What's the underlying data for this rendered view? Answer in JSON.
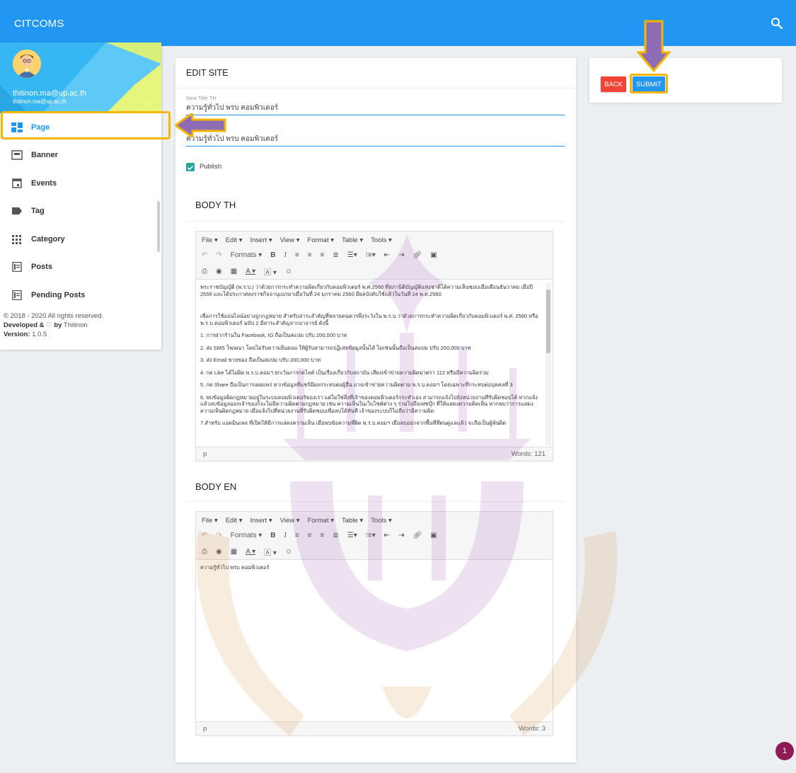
{
  "app": {
    "brand": "CITCOMS"
  },
  "user": {
    "name": "thitinon.ma@up.ac.th",
    "email": "thitinon.ma@up.ac.th"
  },
  "sidebar": {
    "items": [
      {
        "label": "Page",
        "icon": "dashboard-icon",
        "active": true
      },
      {
        "label": "Banner",
        "icon": "banner-icon"
      },
      {
        "label": "Events",
        "icon": "calendar-icon"
      },
      {
        "label": "Tag",
        "icon": "tag-icon"
      },
      {
        "label": "Category",
        "icon": "grid-icon"
      },
      {
        "label": "Posts",
        "icon": "posts-icon"
      },
      {
        "label": "Pending Posts",
        "icon": "pending-posts-icon"
      }
    ],
    "footer": {
      "copyright": "© 2018 - 2020 All rights reserved.",
      "developed_prefix": "Developed &",
      "developed_by": "by",
      "developer": "Thitinon",
      "version_label": "Version:",
      "version": "1.0.5"
    }
  },
  "form": {
    "title": "EDIT SITE",
    "title_th_label": "New Title TH",
    "title_th_value": "ความรู้ทั่วไป พรบ คอมพิวเตอร์",
    "title_en_value": "ความรู้ทั่วไป พรบ คอมพิวเตอร์",
    "publish_label": "Publish",
    "publish_checked": true,
    "body_th_title": "BODY TH",
    "body_en_title": "BODY EN"
  },
  "editor": {
    "menus": [
      "File ▾",
      "Edit ▾",
      "Insert ▾",
      "View ▾",
      "Format ▾",
      "Table ▾",
      "Tools ▾"
    ],
    "formats_label": "Formats ▾",
    "path_label": "p",
    "th_words": "Words: 121",
    "en_words": "Words: 3",
    "th_paragraphs": [
      "พระราชบัญญัติ (พ.ร.บ.) ว่าด้วยการกระทำความผิดเกี่ยวกับคอมพิวเตอร์ พ.ศ.2560 ที่สภานิติบัญญัติแห่งชาติได้ความเห็นชอบเมื่อเดือนธันวาคม เมื่อปี 2559 และได้ประกาศลงราชกิจจานุเบกษาเมื่อวันที่ 24 มกราคม 2560 มีผลบังคับใช้แล้วในวันที่ 24 พ.ค.2560",
      "เพื่อการใช้ออนไลน์อย่างถูกกฎหมาย สำหรับสาระสำคัญที่หลายคนควรพึงระวังใน พ.ร.บ.ว่าด้วยการกระทำความผิดเกี่ยวกับคอมพิวเตอร์ พ.ศ. 2560 หรือ พ.ร.บ.คอมพิวเตอร์ ฉบับ 2 มีสาระสำคัญจากอาจารย์ ดังนี้",
      "1. การฝากร้านใน Facebook, IG ถือเป็นสแปม ปรับ 200,000 บาท",
      "2. ส่ง SMS โฆษณา โดยไม่รับความยินยอม ให้ผู้รับสามารถปฏิเสธข้อมูลนั้นได้ ไม่เช่นนั้นถือเป็นสแปม ปรับ 200,000 บาท",
      "3. ส่ง Email ขายของ ถือเป็นสแปม ปรับ 200,000 บาท",
      "4. กด Like ได้ไม่ผิด พ.ร.บ.คอมฯ ยกเว้นการกดไลค์ เป็นเรื่องเกี่ยวกับสถาบัน เสี่ยงเข้าข่ายความผิดมาตรา 112 หรือมีความผิดร่วม",
      "5. กด Share ถือเป็นการเผยแพร่ หากข้อมูลที่แชร์มีผลกระทบต่อผู้อื่น อาจเข้าข่ายความผิดตาม พ.ร.บ.คอมฯ โดยเฉพาะที่กระทบต่อบุคคลที่ 3",
      "6. พบข้อมูลผิดกฎหมายอยู่ในระบบคอมพิวเตอร์ของเรา แต่ไม่ใช่สิ่งที่เจ้าของคอมพิวเตอร์กระทำเอง สามารถแจ้งไปยังหน่วยงานที่รับผิดชอบได้ หากแจ้งแล้วลบข้อมูลออกเจ้าของก็จะไม่มีความผิดตามกฎหมาย เช่น ความเห็นในเว็บไซต์ต่าง ๆ รวมไปถึงเฟซบุ๊ก ที่ให้แสดงความคิดเห็น หากพบว่าการแสดงความเห็นผิดกฎหมาย เมื่อแจ้งไปที่หน่วยงานที่รับผิดชอบเพื่อลบได้ทันที เจ้าของระบบก็ไม่ถือว่ามีความผิด",
      "7.สำหรับ แอดมินเพจ ที่เปิดให้มีการแสดงความเห็น เมื่อพบข้อความที่ผิด พ.ร.บ.คอมฯ เมื่อลบออกจากพื้นที่ที่ตนดูแลแล้ว จะถือเป็นผู้พ้นผิด"
    ],
    "en_paragraphs": [
      "ความรู้ทั่วไป พรบ คอมพิวเตอร์"
    ]
  },
  "actions": {
    "back_label": "BACK",
    "submit_label": "SUBMIT"
  },
  "notification": {
    "count": "1"
  },
  "colors": {
    "primary": "#2196f3",
    "danger": "#f44336",
    "accent": "#26a69a",
    "highlight": "#f5b400",
    "arrow": "#8e6bb5"
  }
}
